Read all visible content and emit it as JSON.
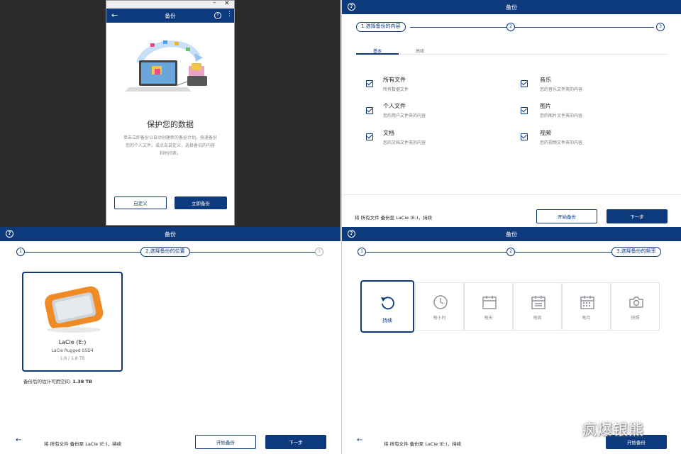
{
  "colors": {
    "navy": "#0c3a7c",
    "dark_bg": "#2b2b2b",
    "orange": "#f08a24"
  },
  "intro": {
    "title": "备份",
    "heading": "保护您的数据",
    "body_line1": "单击立即备份以自动创建新的备份计划，快速备份",
    "body_line2": "您的个人文件。或点击自定义，选择备份的内容",
    "body_line3": "和时间表。",
    "customize_label": "自定义",
    "backup_now_label": "立即备份",
    "icons": [
      "back-arrow-icon",
      "help-icon",
      "more-icon",
      "minimize-icon",
      "close-icon"
    ]
  },
  "content": {
    "title": "备份",
    "step1": "1.选择备份的内容",
    "step2": "2",
    "step3": "3",
    "tab_basic": "基本",
    "tab_advanced": "高级",
    "categories": [
      {
        "title": "所有文件",
        "desc": "所有数据文件",
        "checked": true
      },
      {
        "title": "个人文件",
        "desc": "您的用户文件夹的内容",
        "checked": true
      },
      {
        "title": "文档",
        "desc": "您的文档文件夹的内容",
        "checked": true
      },
      {
        "title": "音乐",
        "desc": "您的音乐文件夹的内容",
        "checked": true
      },
      {
        "title": "图片",
        "desc": "您的图片文件夹的内容",
        "checked": true
      },
      {
        "title": "视频",
        "desc": "您的视频文件夹的内容",
        "checked": true
      }
    ],
    "footer": "将 所有文件 备份至 LaCie (E:)，持续",
    "start_label": "开始备份",
    "next_label": "下一步"
  },
  "location": {
    "title": "备份",
    "step1": "1",
    "step2": "2.选择备份的位置",
    "step3": "3",
    "drive_name": "LaCie (E:)",
    "drive_model": "LaCie Rugged SSD4",
    "drive_size": "1.8 / 1.8 TB",
    "space_label": "备份后的估计可用空间:",
    "space_value": "1.38 TB",
    "footer": "将 所有文件 备份至 LaCie (E:)，持续",
    "start_label": "开始备份",
    "next_label": "下一步"
  },
  "frequency": {
    "title": "备份",
    "step1": "1",
    "step2": "2",
    "step3": "3.选择备份的频率",
    "options": [
      {
        "label": "持续",
        "icon": "continuous-icon",
        "selected": true
      },
      {
        "label": "每小时",
        "icon": "clock-icon",
        "selected": false
      },
      {
        "label": "每天",
        "icon": "calendar-day-icon",
        "selected": false
      },
      {
        "label": "每周",
        "icon": "calendar-week-icon",
        "selected": false
      },
      {
        "label": "每月",
        "icon": "calendar-month-icon",
        "selected": false
      },
      {
        "label": "快照",
        "icon": "camera-icon",
        "selected": false
      }
    ],
    "footer": "将 所有文件 备份至 LaCie (E:)，持续",
    "start_label": "开始备份"
  },
  "watermark": "疯爆银熊"
}
